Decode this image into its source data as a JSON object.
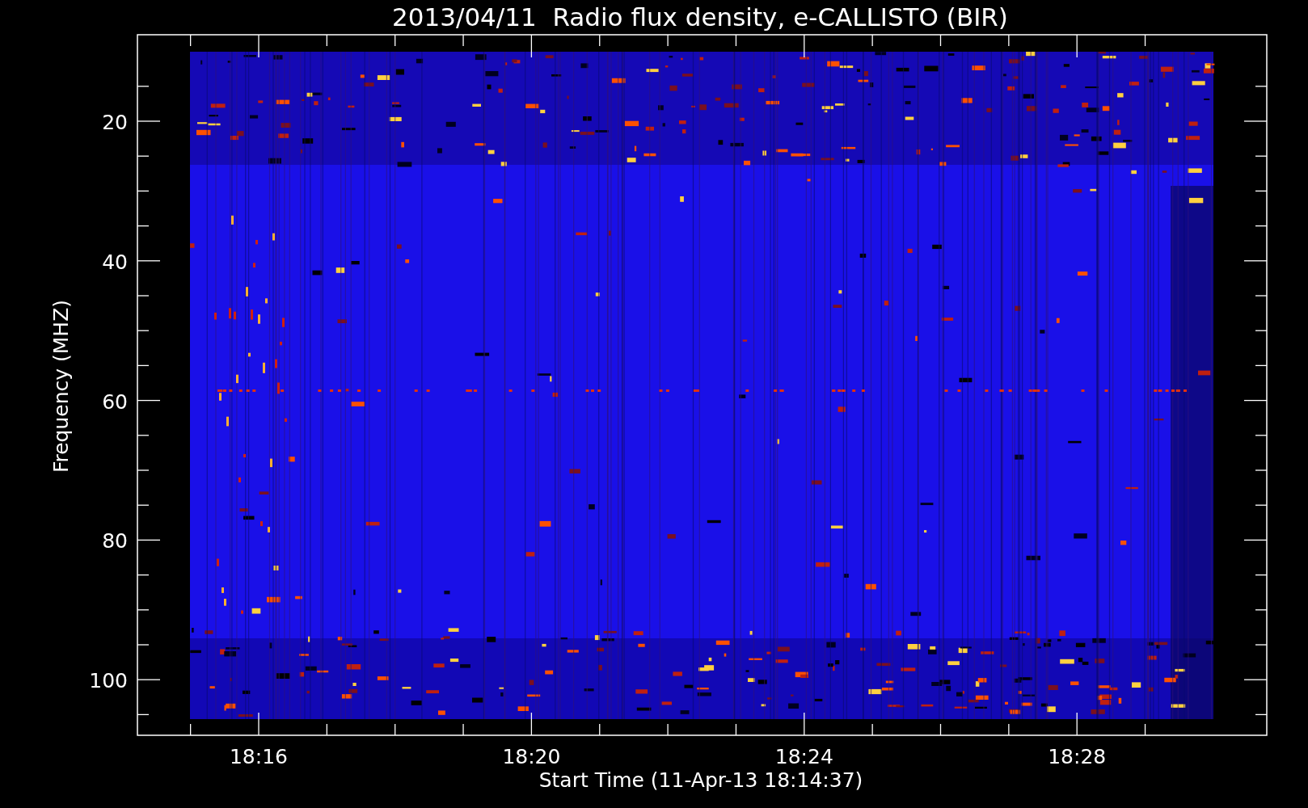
{
  "chart": {
    "title": "2013/04/11  Radio flux density, e-CALLISTO (BIR)",
    "y_axis": {
      "label": "Frequency (MHZ)",
      "ticks": [
        "20",
        "40",
        "60",
        "80",
        "100"
      ]
    },
    "x_axis": {
      "label": "Start Time (11-Apr-13 18:14:37)",
      "ticks": [
        "18:16",
        "18:20",
        "18:24",
        "18:28"
      ]
    }
  }
}
